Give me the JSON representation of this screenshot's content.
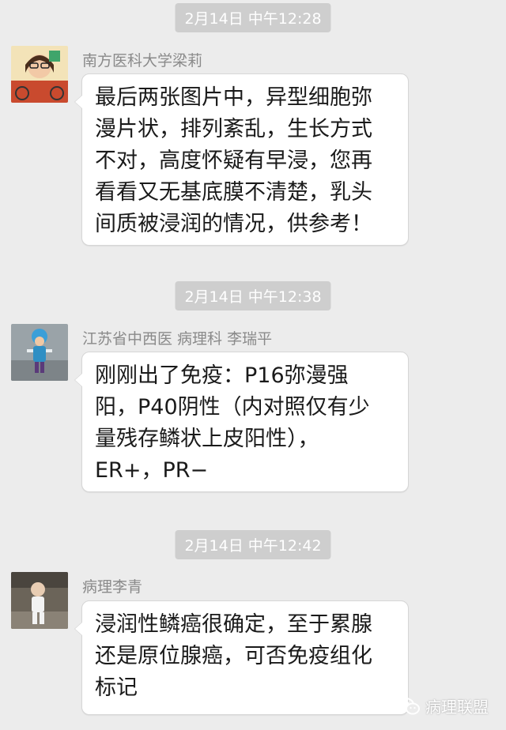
{
  "messages": [
    {
      "timestamp": "2月14日 中午12:28",
      "sender": "南方医科大学梁莉",
      "lines": [
        "最后两张图片中，异型细胞弥",
        "漫片状，排列紊乱，生长方式",
        "不对，高度怀疑有早浸，您再",
        "看看又无基底膜不清楚，乳头",
        "间质被浸润的情况，供参考！"
      ]
    },
    {
      "timestamp": "2月14日 中午12:38",
      "sender": "江苏省中西医 病理科 李瑞平",
      "lines": [
        "刚刚出了免疫：P16弥漫强",
        "阳，P40阴性（内对照仅有少",
        "量残存鳞状上皮阳性），",
        "ER+，PR−"
      ]
    },
    {
      "timestamp": "2月14日 中午12:42",
      "sender": "病理李青",
      "lines": [
        "浸润性鳞癌很确定，至于累腺",
        "还是原位腺癌，可否免疫组化",
        "标记"
      ]
    }
  ],
  "watermark": {
    "text": "病理联盟",
    "icon": "wechat-icon"
  },
  "colors": {
    "background": "#ececec",
    "badge": "#cecece",
    "bubble": "#ffffff",
    "sender": "#8a8a8a"
  }
}
